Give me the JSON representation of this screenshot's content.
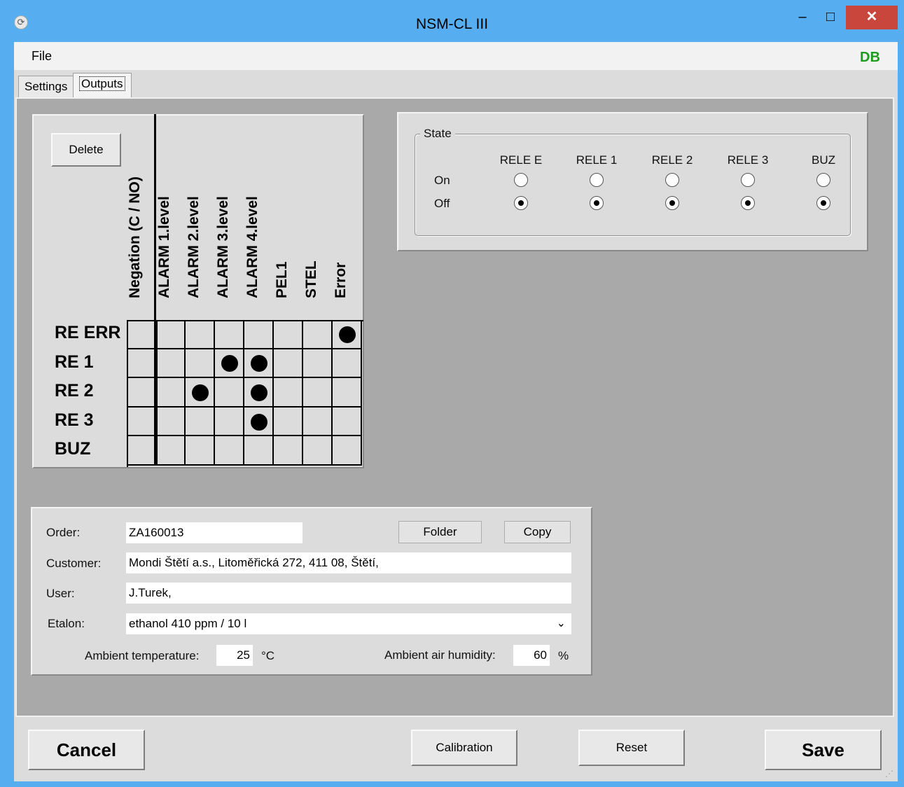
{
  "window": {
    "title": "NSM-CL III",
    "minimize": "–",
    "maximize": "□",
    "close": "✕"
  },
  "menu": {
    "file": "File",
    "db_indicator": "DB"
  },
  "tabs": [
    {
      "label": "Settings"
    },
    {
      "label": "Outputs"
    }
  ],
  "outputs": {
    "delete_label": "Delete",
    "columns": [
      "Negation (C / NO)",
      "ALARM 1.level",
      "ALARM 2.level",
      "ALARM 3.level",
      "ALARM 4.level",
      "PEL1",
      "STEL",
      "Error"
    ],
    "rows": [
      {
        "label": "RE ERR",
        "marks": [
          false,
          false,
          false,
          false,
          false,
          false,
          false,
          true
        ]
      },
      {
        "label": "RE 1",
        "marks": [
          false,
          false,
          false,
          true,
          true,
          false,
          false,
          false
        ]
      },
      {
        "label": "RE 2",
        "marks": [
          false,
          false,
          true,
          false,
          true,
          false,
          false,
          false
        ]
      },
      {
        "label": "RE 3",
        "marks": [
          false,
          false,
          false,
          false,
          true,
          false,
          false,
          false
        ]
      },
      {
        "label": "BUZ",
        "marks": [
          false,
          false,
          false,
          false,
          false,
          false,
          false,
          false
        ]
      }
    ]
  },
  "state": {
    "legend": "State",
    "on_label": "On",
    "off_label": "Off",
    "relays": [
      {
        "name": "RELE E",
        "value": "Off"
      },
      {
        "name": "RELE 1",
        "value": "Off"
      },
      {
        "name": "RELE 2",
        "value": "Off"
      },
      {
        "name": "RELE 3",
        "value": "Off"
      },
      {
        "name": "BUZ",
        "value": "Off"
      }
    ]
  },
  "info": {
    "order_label": "Order:",
    "order_value": "ZA160013",
    "folder_label": "Folder",
    "copy_label": "Copy",
    "customer_label": "Customer:",
    "customer_value": "Mondi Štětí a.s., Litoměřická 272, 411 08, Štětí,",
    "user_label": "User:",
    "user_value": "J.Turek,",
    "etalon_label": "Etalon:",
    "etalon_value": "ethanol 410 ppm / 10 l",
    "temp_label": "Ambient temperature:",
    "temp_value": "25",
    "temp_unit": "°C",
    "humidity_label": "Ambient air humidity:",
    "humidity_value": "60",
    "humidity_unit": "%"
  },
  "footer": {
    "cancel": "Cancel",
    "calibration": "Calibration",
    "reset": "Reset",
    "save": "Save"
  }
}
